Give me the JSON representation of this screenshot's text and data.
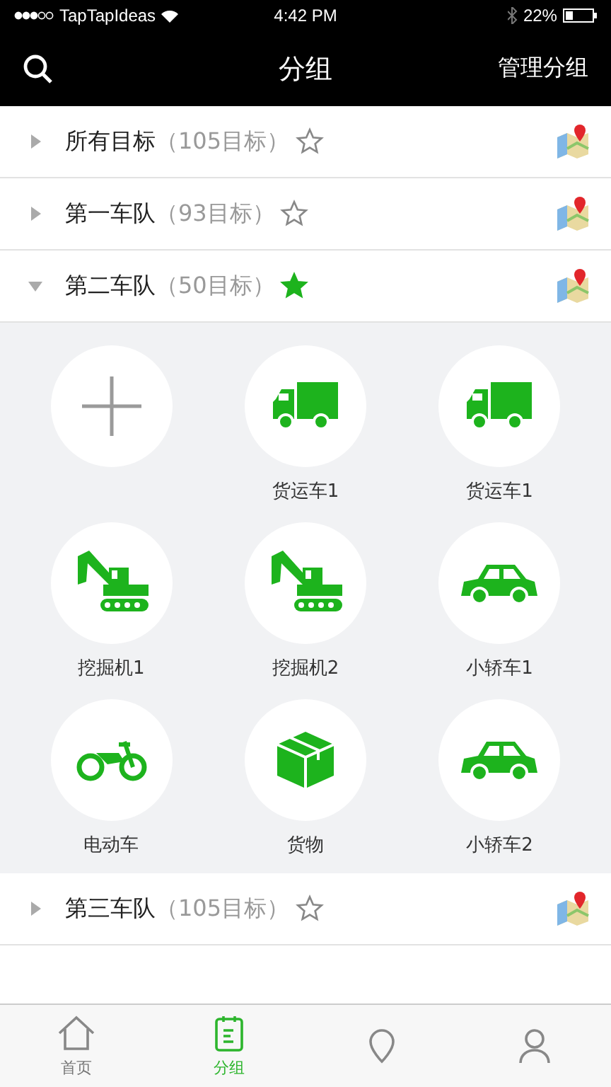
{
  "status_bar": {
    "carrier": "TapTapIdeas",
    "time": "4:42 PM",
    "battery": "22%"
  },
  "nav": {
    "title": "分组",
    "action": "管理分组"
  },
  "groups": [
    {
      "name": "所有目标",
      "count": "（105目标）",
      "starred": false,
      "expanded": false
    },
    {
      "name": "第一车队",
      "count": "（93目标）",
      "starred": false,
      "expanded": false
    },
    {
      "name": "第二车队",
      "count": "（50目标）",
      "starred": true,
      "expanded": true,
      "members": [
        {
          "kind": "add"
        },
        {
          "kind": "truck",
          "label": "货运车1"
        },
        {
          "kind": "truck",
          "label": "货运车1"
        },
        {
          "kind": "excavator",
          "label": "挖掘机1"
        },
        {
          "kind": "excavator",
          "label": "挖掘机2"
        },
        {
          "kind": "car",
          "label": "小轿车1"
        },
        {
          "kind": "motorcycle",
          "label": "电动车"
        },
        {
          "kind": "box",
          "label": "货物"
        },
        {
          "kind": "car",
          "label": "小轿车2"
        }
      ]
    },
    {
      "name": "第三车队",
      "count": "（105目标）",
      "starred": false,
      "expanded": false
    }
  ],
  "tab_bar": [
    {
      "kind": "home",
      "label": "首页",
      "selected": false
    },
    {
      "kind": "group",
      "label": "分组",
      "selected": true
    },
    {
      "kind": "map",
      "selected": false
    },
    {
      "kind": "person",
      "selected": false
    }
  ]
}
